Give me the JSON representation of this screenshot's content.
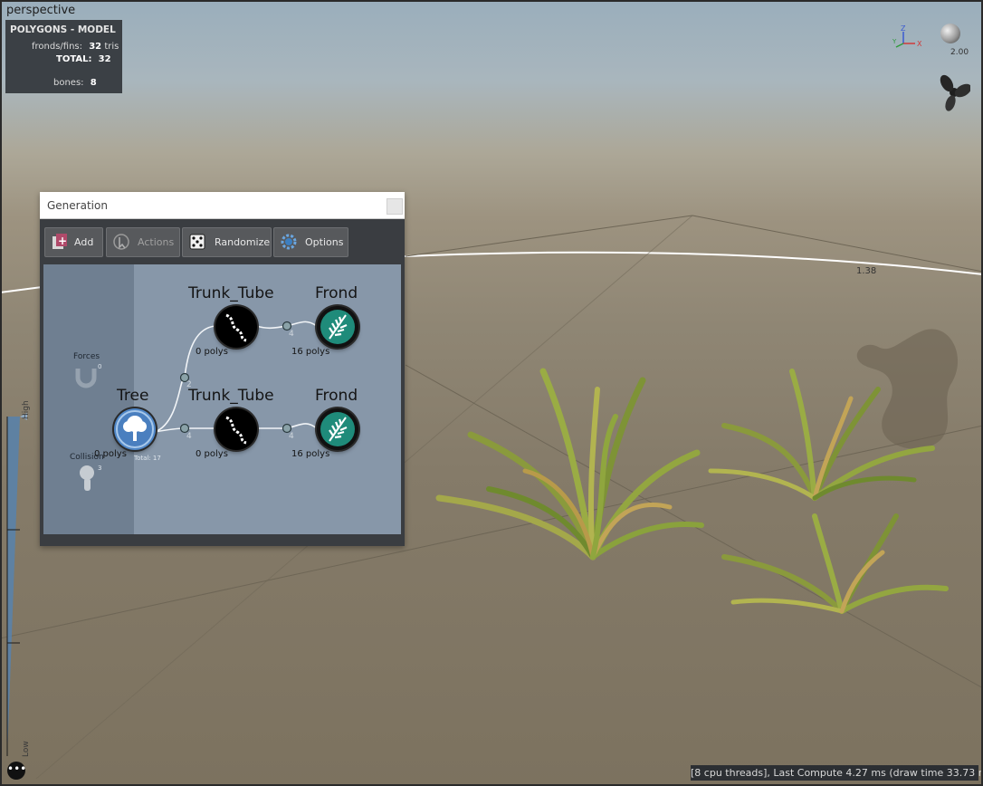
{
  "viewport": {
    "label": "perspective",
    "zoom": "2.00",
    "ruler_value": "1.38",
    "axes": {
      "z": "Z",
      "y": "Y",
      "x": "X"
    }
  },
  "stats": {
    "title": "POLYGONS - MODEL",
    "fronds_label": "fronds/fins:",
    "fronds_value": "32",
    "fronds_unit": "tris",
    "total_label": "TOTAL:",
    "total_value": "32",
    "bones_label": "bones:",
    "bones_value": "8"
  },
  "lod": {
    "high": "High",
    "low": "Low"
  },
  "status_bar": "[8 cpu threads], Last Compute 4.27 ms (draw time 33.73 ms)",
  "generation": {
    "title": "Generation",
    "toolbar": {
      "add": "Add",
      "actions": "Actions",
      "randomize": "Randomize",
      "options": "Options"
    },
    "side": {
      "forces_label": "Forces",
      "forces_count": "0",
      "collision_label": "Collision",
      "collision_count": "3"
    },
    "nodes": {
      "tree": {
        "name": "Tree",
        "polys": "0 polys",
        "total": "Total: 17"
      },
      "trunk1": {
        "name": "Trunk_Tube",
        "polys": "0 polys"
      },
      "frond1": {
        "name": "Frond",
        "polys": "16 polys"
      },
      "trunk2": {
        "name": "Trunk_Tube",
        "polys": "0 polys"
      },
      "frond2": {
        "name": "Frond",
        "polys": "16 polys"
      }
    },
    "connectors": {
      "split": "2",
      "c_trunk1": "4",
      "c_frond1": "4",
      "c_trunk2": "4",
      "c_frond2": "4"
    }
  },
  "colors": {
    "graph_bg": "#8797a9",
    "frond_node": "#1f8b7a",
    "tree_node": "#4f86c6",
    "status_bg": "#2c2f33"
  }
}
